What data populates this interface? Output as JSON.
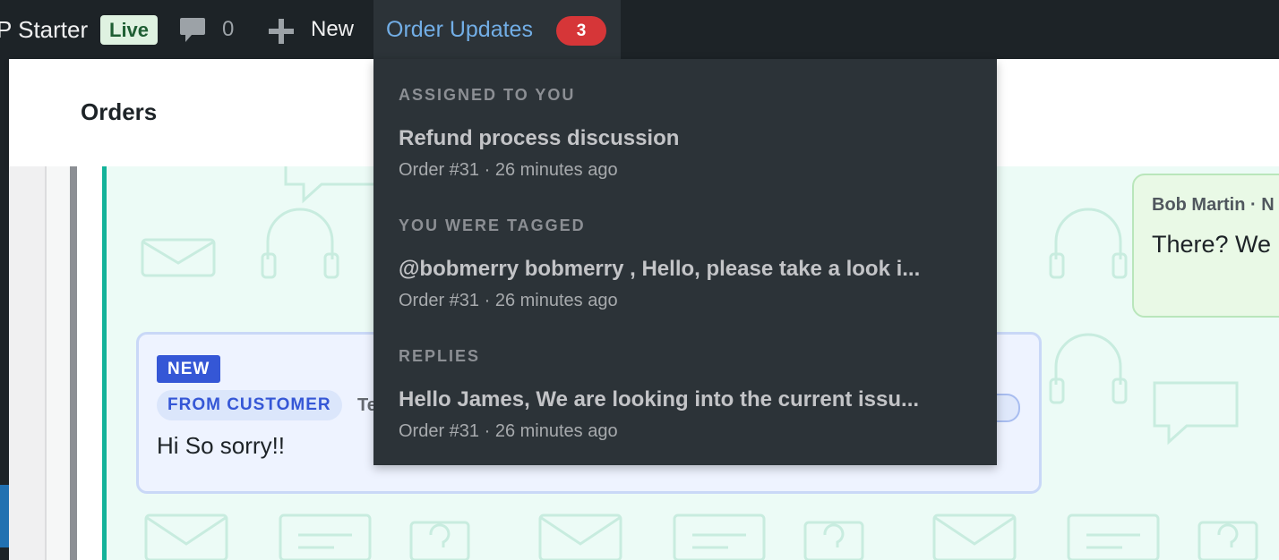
{
  "adminbar": {
    "site_name": "P Starter",
    "live_badge": "Live",
    "comment_count": "0",
    "new_label": "New",
    "updates_label": "Order Updates",
    "updates_count": "3"
  },
  "page": {
    "title": "Orders"
  },
  "dropdown": {
    "sections": [
      {
        "heading": "ASSIGNED TO YOU",
        "title": "Refund process discussion",
        "meta": "Order #31 · 26 minutes ago"
      },
      {
        "heading": "YOU WERE TAGGED",
        "title": "@bobmerry bobmerry , Hello, please take a look i...",
        "meta": "Order #31 · 26 minutes ago"
      },
      {
        "heading": "REPLIES",
        "title": "Hello James, We are looking into the current issu...",
        "meta": "Order #31 · 26 minutes ago"
      }
    ]
  },
  "messages": {
    "right": {
      "author": "Bob Martin · N",
      "text": "There? We"
    },
    "left": {
      "new_badge": "NEW",
      "from_badge": "FROM CUSTOMER",
      "author_fragment": "Te",
      "text": "Hi So sorry!!"
    }
  },
  "colors": {
    "admin_bar": "#1d2327",
    "dropdown": "#2c3338",
    "link_blue": "#72aee6",
    "badge_red": "#d63638",
    "accent_teal": "#13b39a",
    "new_badge": "#3557d6"
  }
}
